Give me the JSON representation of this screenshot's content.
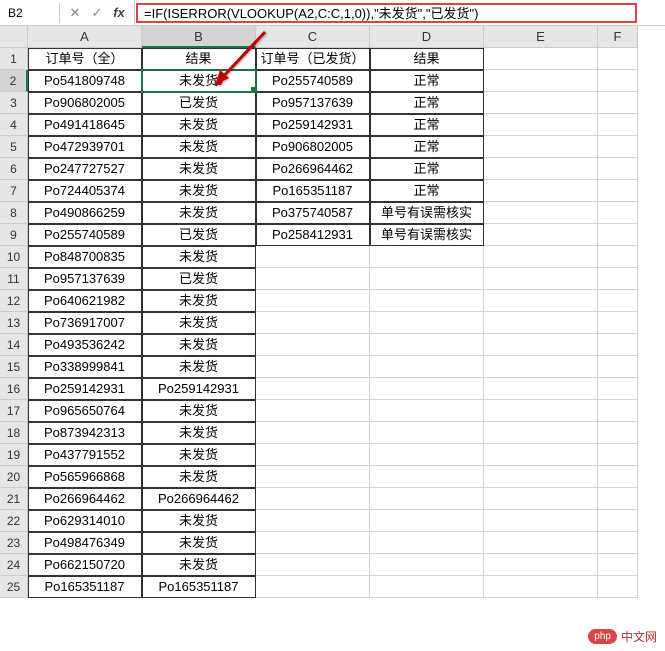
{
  "nameBox": "B2",
  "formula": "=IF(ISERROR(VLOOKUP(A2,C:C,1,0)),\"未发货\",\"已发货\")",
  "columns": [
    "A",
    "B",
    "C",
    "D",
    "E",
    "F"
  ],
  "headers": {
    "A": "订单号（全）",
    "B": "结果",
    "C": "订单号（已发货）",
    "D": "结果"
  },
  "rows": [
    {
      "A": "Po541809748",
      "B": "未发货",
      "C": "Po255740589",
      "D": "正常"
    },
    {
      "A": "Po906802005",
      "B": "已发货",
      "C": "Po957137639",
      "D": "正常"
    },
    {
      "A": "Po491418645",
      "B": "未发货",
      "C": "Po259142931",
      "D": "正常"
    },
    {
      "A": "Po472939701",
      "B": "未发货",
      "C": "Po906802005",
      "D": "正常"
    },
    {
      "A": "Po247727527",
      "B": "未发货",
      "C": "Po266964462",
      "D": "正常"
    },
    {
      "A": "Po724405374",
      "B": "未发货",
      "C": "Po165351187",
      "D": "正常"
    },
    {
      "A": "Po490866259",
      "B": "未发货",
      "C": "Po375740587",
      "D": "单号有误需核实"
    },
    {
      "A": "Po255740589",
      "B": "已发货",
      "C": "Po258412931",
      "D": "单号有误需核实"
    },
    {
      "A": "Po848700835",
      "B": "未发货"
    },
    {
      "A": "Po957137639",
      "B": "已发货"
    },
    {
      "A": "Po640621982",
      "B": "未发货"
    },
    {
      "A": "Po736917007",
      "B": "未发货"
    },
    {
      "A": "Po493536242",
      "B": "未发货"
    },
    {
      "A": "Po338999841",
      "B": "未发货"
    },
    {
      "A": "Po259142931",
      "B": "Po259142931"
    },
    {
      "A": "Po965650764",
      "B": "未发货"
    },
    {
      "A": "Po873942313",
      "B": "未发货"
    },
    {
      "A": "Po437791552",
      "B": "未发货"
    },
    {
      "A": "Po565966868",
      "B": "未发货"
    },
    {
      "A": "Po266964462",
      "B": "Po266964462"
    },
    {
      "A": "Po629314010",
      "B": "未发货"
    },
    {
      "A": "Po498476349",
      "B": "未发货"
    },
    {
      "A": "Po662150720",
      "B": "未发货"
    },
    {
      "A": "Po165351187",
      "B": "Po165351187"
    }
  ],
  "activeCell": {
    "row": 2,
    "col": "B"
  },
  "watermark": {
    "logo": "php",
    "text": "中文网"
  }
}
